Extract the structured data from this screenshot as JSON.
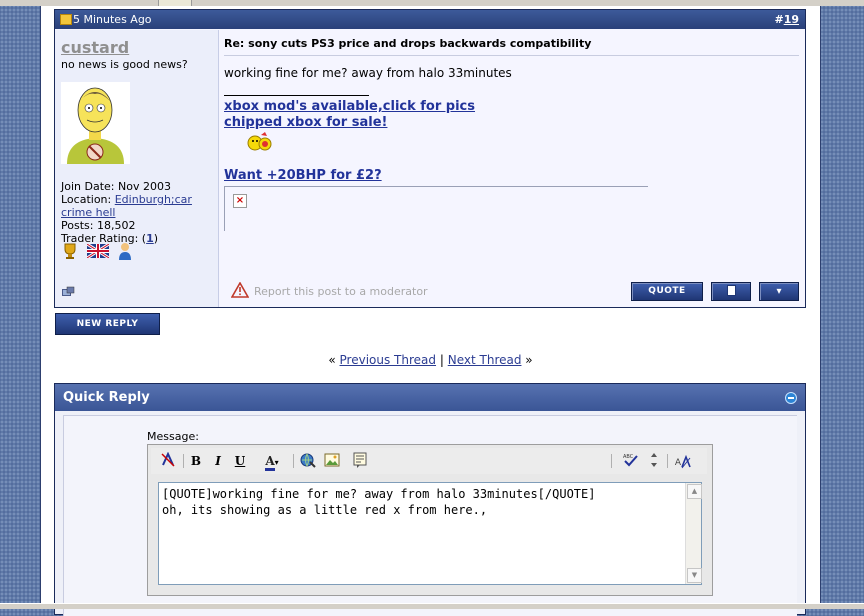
{
  "post": {
    "time": "5 Minutes Ago",
    "number_prefix": "#",
    "number": "19",
    "username": "custard",
    "user_title": "no news is good news?",
    "join_date": "Join Date: Nov 2003",
    "location_label": "Location: ",
    "location": "Edinburgh;car crime hell",
    "posts": "Posts: 18,502",
    "trader_label": "Trader Rating: (",
    "trader_value": "1",
    "trader_close": ")",
    "title": "Re: sony cuts PS3 price and drops backwards compatibility",
    "message": "working fine for me? away from halo 33minutes",
    "sig_link1": "xbox mod's available,click for pics",
    "sig_link2": "chipped xbox for sale!",
    "sig_link3": "Want +20BHP for £2?",
    "broken_image": "×",
    "report": "Report this post to a moderator",
    "quote_button": "QUOTE"
  },
  "actions": {
    "new_reply": "NEW REPLY"
  },
  "nav": {
    "left_arrows": "«",
    "prev": "Previous Thread",
    "divider": "|",
    "next": "Next Thread",
    "right_arrows": "»"
  },
  "quick_reply": {
    "title": "Quick Reply",
    "message_label": "Message:",
    "toolbar": {
      "bold": "B",
      "italic": "I",
      "underline": "U",
      "font_color": "A",
      "font_size": "A"
    },
    "text": "[QUOTE]working fine for me? away from halo 33minutes[/QUOTE]\noh, its showing as a little red x from here.,"
  },
  "colors": {
    "header_blue": "#2a4079",
    "link": "#2b3c92",
    "signature_link": "#22339a"
  }
}
